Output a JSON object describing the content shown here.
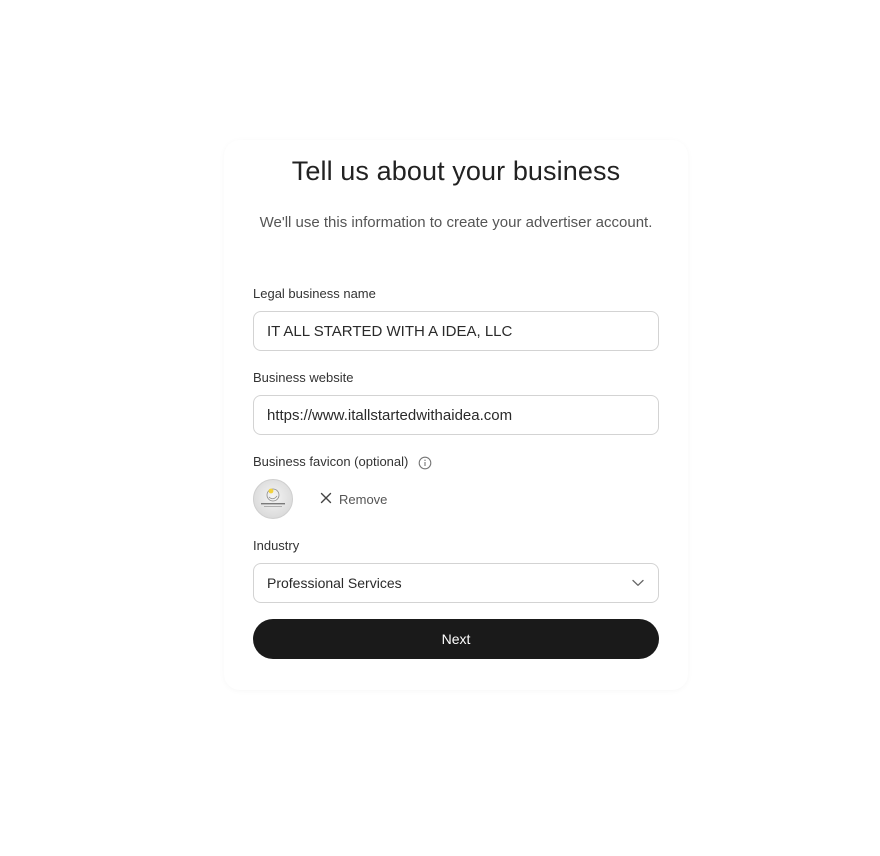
{
  "header": {
    "title": "Tell us about your business",
    "subtitle": "We'll use this information to create your advertiser account."
  },
  "form": {
    "legal_name": {
      "label": "Legal business name",
      "value": "IT ALL STARTED WITH A IDEA, LLC"
    },
    "website": {
      "label": "Business website",
      "value": "https://www.itallstartedwithaidea.com"
    },
    "favicon": {
      "label": "Business favicon (optional)",
      "remove_label": "Remove"
    },
    "industry": {
      "label": "Industry",
      "selected": "Professional Services"
    },
    "next_label": "Next"
  },
  "icons": {
    "info": "info-icon",
    "remove": "close-icon",
    "dropdown": "chevron-down-icon"
  }
}
